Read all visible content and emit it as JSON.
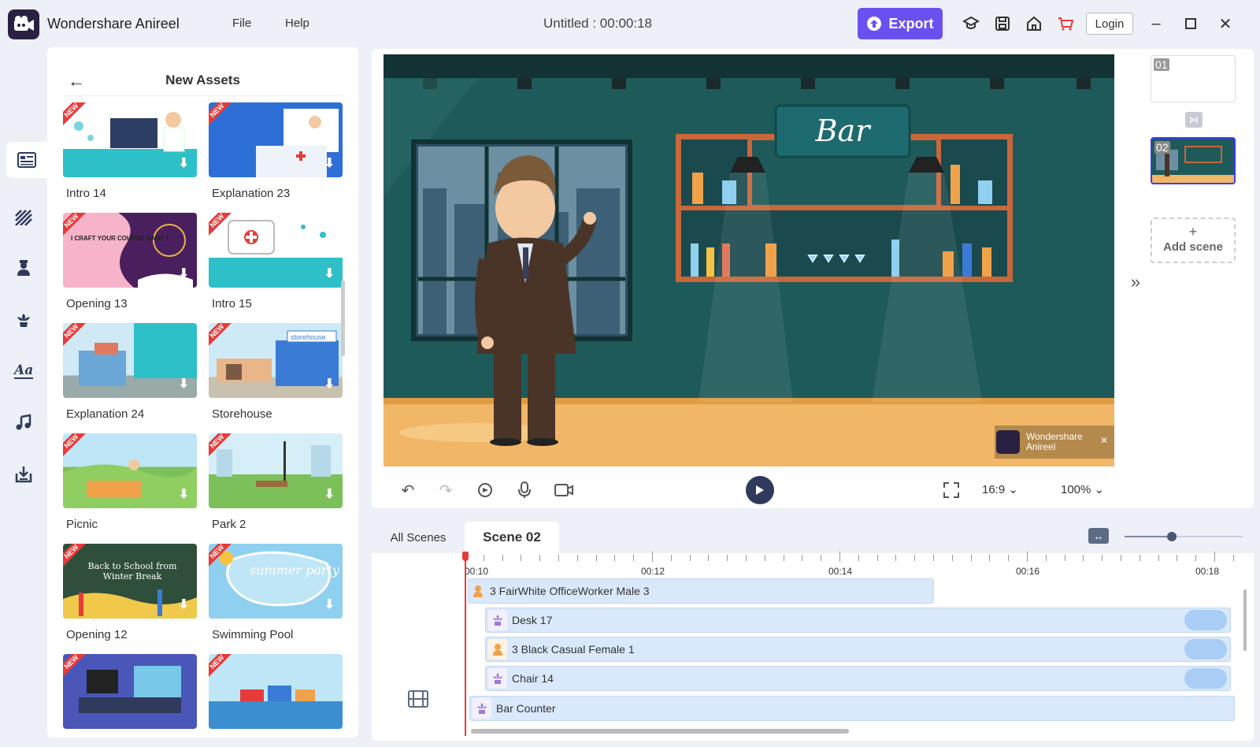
{
  "app": {
    "title": "Wondershare Anireel",
    "menu": [
      "File",
      "Help"
    ],
    "document_title": "Untitled : 00:00:18",
    "export_label": "Export",
    "login_label": "Login",
    "accent_color": "#6b50f0"
  },
  "rail": {
    "icons": [
      "templates-icon",
      "background-icon",
      "character-icon",
      "props-icon",
      "text-icon",
      "music-icon",
      "import-icon"
    ]
  },
  "assets": {
    "title": "New Assets",
    "items": [
      {
        "label": "Intro 14"
      },
      {
        "label": "Explanation 23"
      },
      {
        "label": "Opening 13"
      },
      {
        "label": "Intro 15"
      },
      {
        "label": "Explanation 24"
      },
      {
        "label": "Storehouse"
      },
      {
        "label": "Picnic"
      },
      {
        "label": "Park 2"
      },
      {
        "label": "Opening 12"
      },
      {
        "label": "Swimming Pool"
      },
      {
        "label": ""
      },
      {
        "label": ""
      }
    ],
    "badge": "NEW",
    "thumb_text": {
      "storehouse": "storehouse",
      "opening12": "Back to School from Winter Break",
      "opening13": "I CRAFT YOUR COURSE NAME !",
      "swimming": "summer party"
    }
  },
  "stage": {
    "sign_text": "Bar",
    "watermark": "Wondershare Anireel",
    "watermark_line1": "Wondershare",
    "watermark_line2": "Anireel"
  },
  "toolbar": {
    "ratio": "16:9",
    "zoom": "100%"
  },
  "scenes": {
    "items": [
      {
        "num": "01"
      },
      {
        "num": "02"
      }
    ],
    "add_label": "Add scene"
  },
  "timeline": {
    "tabs": [
      "All Scenes",
      "Scene 02"
    ],
    "ruler_labels": [
      "00:10",
      "00:12",
      "00:14",
      "00:16",
      "00:18"
    ],
    "zoom_slider": 0.4,
    "tracks": [
      {
        "label": "3 FairWhite OfficeWorker Male 3",
        "type": "character"
      },
      {
        "label": "Desk 17",
        "type": "prop"
      },
      {
        "label": "3 Black Casual Female 1",
        "type": "character"
      },
      {
        "label": "Chair 14",
        "type": "prop"
      },
      {
        "label": "Bar Counter",
        "type": "prop"
      }
    ]
  }
}
